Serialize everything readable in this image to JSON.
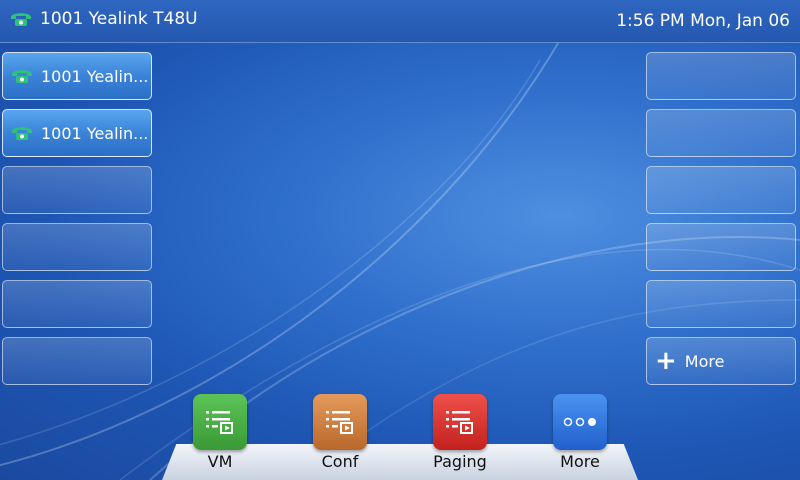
{
  "topbar": {
    "account": "1001 Yealink T48U",
    "datetime": "1:56 PM Mon, Jan 06"
  },
  "left_keys": [
    {
      "label": "1001 Yealin...",
      "icon": "phone-icon",
      "active": true
    },
    {
      "label": "1001 Yealin...",
      "icon": "phone-icon",
      "active": true
    },
    {
      "label": ""
    },
    {
      "label": ""
    },
    {
      "label": ""
    },
    {
      "label": ""
    }
  ],
  "right_keys": [
    {
      "label": ""
    },
    {
      "label": ""
    },
    {
      "label": ""
    },
    {
      "label": ""
    },
    {
      "label": ""
    },
    {
      "label": "More",
      "icon": "plus-icon"
    }
  ],
  "softkeys": [
    {
      "label": "VM",
      "icon": "list-play-icon",
      "color": "#43a83f"
    },
    {
      "label": "Conf",
      "icon": "list-play-icon",
      "color": "#c9783a"
    },
    {
      "label": "Paging",
      "icon": "list-play-icon",
      "color": "#d8332f"
    },
    {
      "label": "More",
      "icon": "dots-icon",
      "color": "#2e73de"
    }
  ],
  "colors": {
    "phone_icon": "#2ec27a",
    "background": "#2a62c0"
  }
}
